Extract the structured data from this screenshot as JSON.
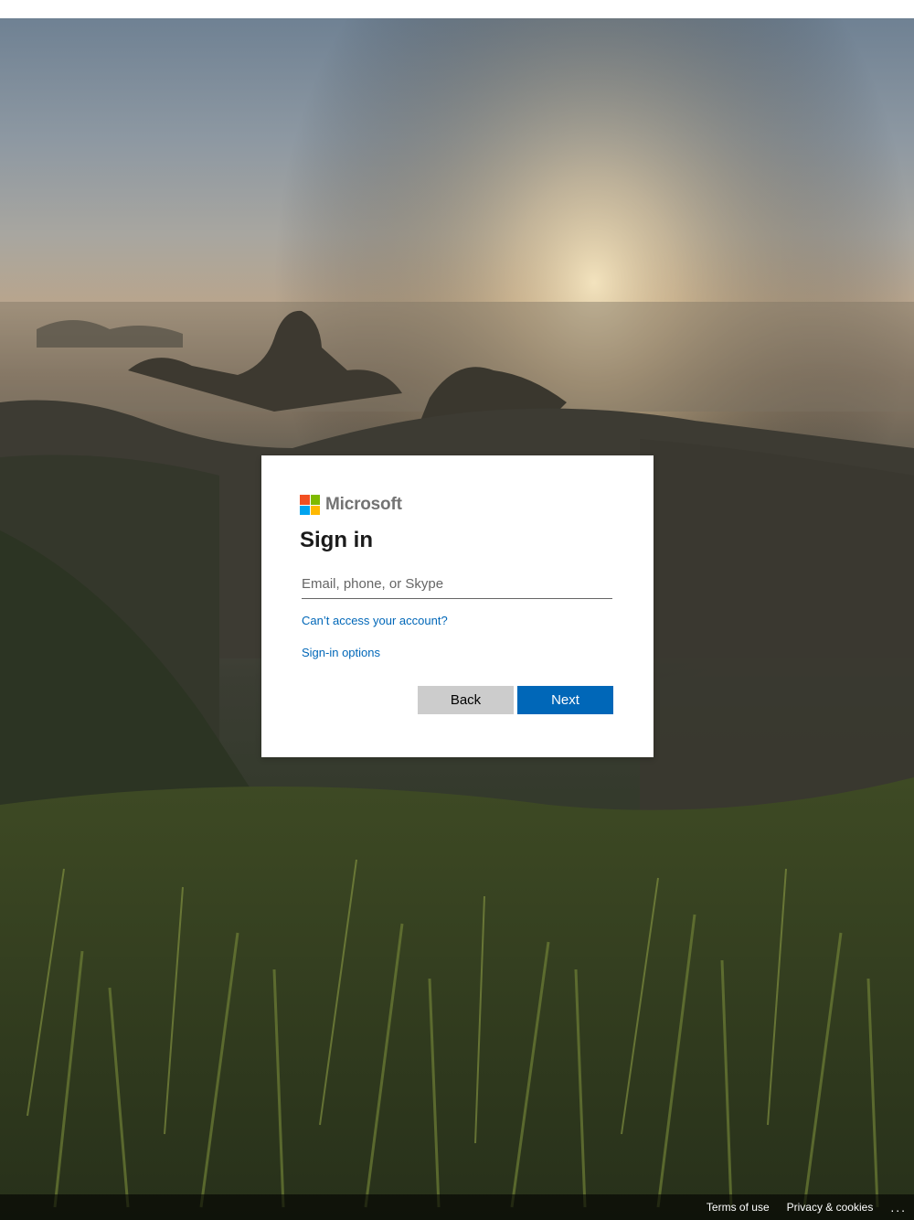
{
  "brand": {
    "name": "Microsoft",
    "logo_colors": [
      "#f25022",
      "#7fba00",
      "#00a4ef",
      "#ffb900"
    ]
  },
  "signin": {
    "title": "Sign in",
    "input_placeholder": "Email, phone, or Skype",
    "input_value": "",
    "cant_access_link": "Can’t access your account?",
    "options_link": "Sign-in options",
    "back_label": "Back",
    "next_label": "Next"
  },
  "footer": {
    "terms": "Terms of use",
    "privacy": "Privacy & cookies",
    "more": "..."
  },
  "colors": {
    "accent": "#0067b8",
    "secondary_button": "#cccccc"
  }
}
